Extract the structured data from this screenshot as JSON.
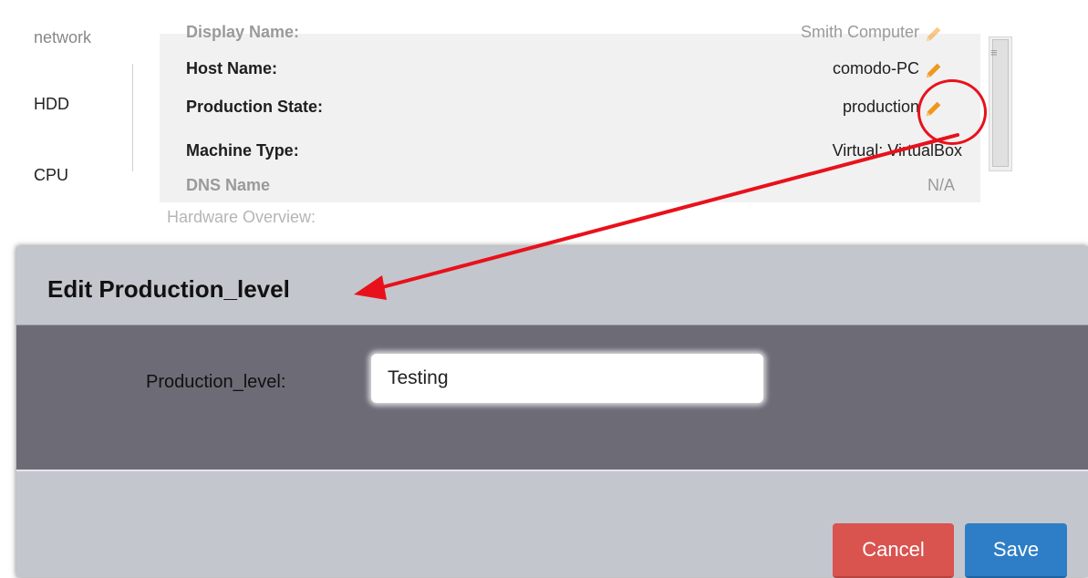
{
  "nav": {
    "items": [
      {
        "label": "network",
        "faded": true
      },
      {
        "label": "HDD",
        "faded": false
      },
      {
        "label": "CPU",
        "faded": false
      }
    ]
  },
  "info": {
    "rows": [
      {
        "label": "Display Name:",
        "value": "Smith Computer",
        "editable": true,
        "faded": true
      },
      {
        "label": "Host Name:",
        "value": "comodo-PC",
        "editable": true,
        "faded": false
      },
      {
        "label": "Production State:",
        "value": "production",
        "editable": true,
        "faded": false
      },
      {
        "label": "Machine Type:",
        "value": "Virtual: VirtualBox",
        "editable": false,
        "faded": false
      },
      {
        "label": "DNS Name",
        "value": "N/A",
        "editable": false,
        "faded": true
      }
    ],
    "hardware_overview": "Hardware Overview:"
  },
  "dialog": {
    "title": "Edit Production_level",
    "field_label": "Production_level:",
    "field_value": "Testing",
    "cancel_label": "Cancel",
    "save_label": "Save"
  },
  "colors": {
    "annotation_red": "#e8111b",
    "pencil_orange": "#f0971c",
    "cancel_red": "#d9534f",
    "save_blue": "#2d7ec6",
    "dialog_body": "#6d6b76",
    "dialog_header": "#c4c6cd"
  },
  "icons": {
    "edit": "pencil-icon"
  }
}
